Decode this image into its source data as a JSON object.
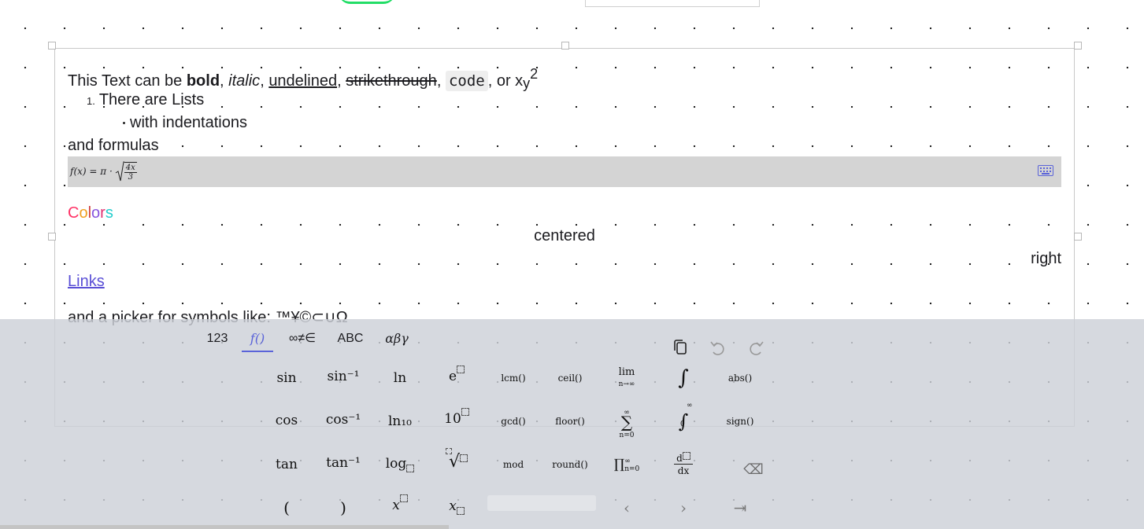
{
  "document": {
    "formatting_line": {
      "prefix": "This Text can be ",
      "bold": "bold",
      "sep1": ", ",
      "italic": "italic",
      "sep2": ", ",
      "underlined": "undelined",
      "sep3": ", ",
      "strike": "strikethrough",
      "sep4": ", ",
      "code": "code",
      "sep5": ", or x",
      "sub": "y",
      "sup": "2"
    },
    "list_number": "1.",
    "list_item": "There are Lists",
    "sublist_item": "with indentations",
    "formulas_label": "and formulas",
    "formula": {
      "lhs": "f(x) = π ·",
      "num": "4x",
      "den": "3"
    },
    "colors": [
      "C",
      "o",
      "l",
      "o",
      "r",
      "s"
    ],
    "color_values": [
      "#ff3366",
      "#f0a020",
      "#d04040",
      "#8855dd",
      "#e03070",
      "#22cccc"
    ],
    "centered": "centered",
    "right": "right",
    "links": "Links",
    "symbols_line": "and a picker for symbols like:  ™¥©⊂∪Ω"
  },
  "keyboard": {
    "tabs": [
      "123",
      "f()",
      "∞≠∈",
      "ABC",
      "αβγ"
    ],
    "active_tab": "f()",
    "actions": {
      "copy": "copy-icon",
      "undo": "undo-icon",
      "redo": "redo-icon"
    },
    "rows": [
      [
        "sin",
        "sin⁻¹",
        "ln",
        "e",
        "lcm()",
        "ceil()",
        "lim",
        "∫",
        "abs()"
      ],
      [
        "cos",
        "cos⁻¹",
        "ln₁₀",
        "10",
        "gcd()",
        "floor()",
        "∑",
        "∫₀^∞",
        "sign()"
      ],
      [
        "tan",
        "tan⁻¹",
        "log",
        "√",
        "mod",
        "round()",
        "∏",
        "d/dx",
        "⌫"
      ],
      [
        "(",
        ")",
        "x",
        "x",
        "",
        "",
        "‹",
        "›",
        "⇥"
      ]
    ],
    "lim_sub": "n→∞",
    "sum_top": "∞",
    "sum_bottom": "n=0",
    "prod_label": "∏∞n=0",
    "int_top": "∞",
    "int_bottom": "0",
    "deriv_top": "d",
    "deriv_bottom": "dx"
  }
}
